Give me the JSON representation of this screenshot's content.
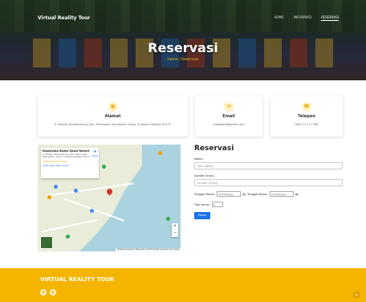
{
  "header": {
    "brand": "Virtual Reality Tour",
    "nav": [
      "Home",
      "Informasi",
      "Reservasi"
    ],
    "active_nav": "Reservasi",
    "title": "Reservasi",
    "breadcrumb": "Home / Reservasi"
  },
  "contact_cards": [
    {
      "icon": "map-icon",
      "title": "Alamat",
      "value": "Jl. Wisata, Bontoparang, Kec. Parangloe, Kabupaten Gowa, Sulawesi Selatan 92173"
    },
    {
      "icon": "mail-icon",
      "title": "Email",
      "value": "butagowa@gmail.com"
    },
    {
      "icon": "phone-icon",
      "title": "Telepon",
      "value": "0822 1111 7766"
    }
  ],
  "map": {
    "place_name": "Ekowisata Butta Gowa Resort",
    "address": "Jl. Wisata, Bontoparang, Kec. Parangloe, Kabupaten Gowa, Sulawesi Selatan 92173",
    "rating": "★★★★★ 155 ulasan",
    "link": "Lihat peta lebih besar",
    "directions": "Rute",
    "footer": "Pintasan keyboard  Data peta ©2023  Syarat  Laporkan error peta"
  },
  "form": {
    "title": "Reservasi",
    "name_label": "Nama",
    "name_placeholder": "Your Name",
    "qty_label": "Jumlah Orang",
    "qty_placeholder": "Jumlah Orang",
    "checkin_label": "Tanggal Masuk:",
    "checkin_placeholder": "mm/dd/yyyy",
    "checkout_label": "Tanggal Keluar:",
    "checkout_placeholder": "mm/dd/yyyy",
    "room_label": "Tipe kamar:",
    "room_value": "",
    "submit_label": "Pesan"
  },
  "footer": {
    "title": "VIRTUAL REALITY TOUR"
  },
  "colors": {
    "accent": "#f5b400",
    "primary_button": "#1a73e8"
  }
}
